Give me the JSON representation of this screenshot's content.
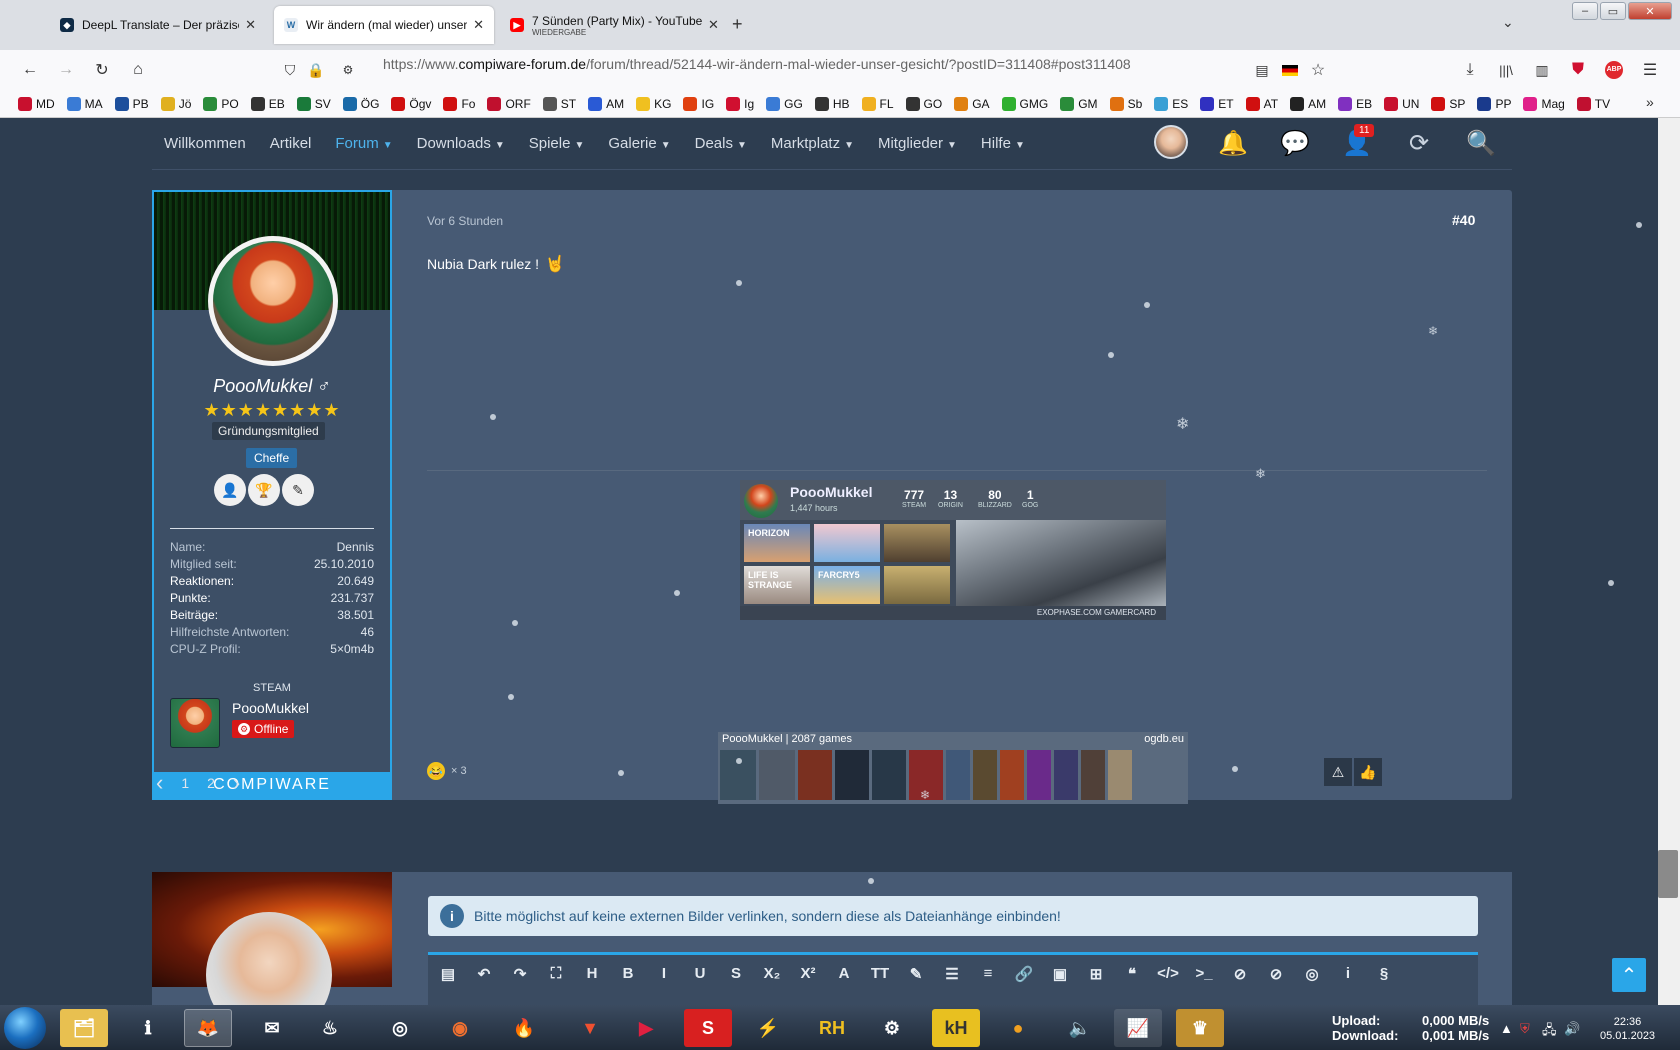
{
  "browser": {
    "tabs": [
      {
        "title": "DeepL Translate – Der präziseste",
        "active": false
      },
      {
        "title": "Wir ändern (mal wieder) unser G",
        "active": true
      },
      {
        "title": "7 Sünden (Party Mix) - YouTube",
        "subtitle": "WIEDERGABE",
        "active": false
      }
    ],
    "new_tab": "+",
    "url_prefix": "https://www.",
    "url_domain": "compiware-forum.de",
    "url_path": "/forum/thread/52144-wir-ändern-mal-wieder-unser-gesicht/?postID=311408#post311408",
    "bookmarks": [
      "MD",
      "MA",
      "PB",
      "Jö",
      "PO",
      "EB",
      "SV",
      "ÖG",
      "Ögv",
      "Fo",
      "ORF",
      "ST",
      "AM",
      "KG",
      "IG",
      "Ig",
      "GG",
      "HB",
      "FL",
      "GO",
      "GA",
      "GMG",
      "GM",
      "Sb",
      "ES",
      "ET",
      "AT",
      "AM",
      "EB",
      "UN",
      "SP",
      "PP",
      "Mag",
      "TV"
    ],
    "bookmark_colors": [
      "#c8102e",
      "#3a7bd5",
      "#1d4f9c",
      "#e0b020",
      "#2a8c3a",
      "#333333",
      "#1a7a3a",
      "#1a6aa8",
      "#d01010",
      "#d01010",
      "#c0102e",
      "#555555",
      "#2a5ad5",
      "#f0c020",
      "#e04010",
      "#d01030",
      "#3a7bd5",
      "#333333",
      "#f0b020",
      "#333333",
      "#e08010",
      "#30b030",
      "#2a8c3a",
      "#e07010",
      "#3aa0d5",
      "#3030c0",
      "#d01010",
      "#222222",
      "#8030c0",
      "#c8102e",
      "#d01010",
      "#1a3a8c",
      "#e0208a",
      "#c01030"
    ]
  },
  "site": {
    "nav": [
      {
        "label": "Willkommen",
        "active": false,
        "dropdown": false
      },
      {
        "label": "Artikel",
        "active": false,
        "dropdown": false
      },
      {
        "label": "Forum",
        "active": true,
        "dropdown": true
      },
      {
        "label": "Downloads",
        "active": false,
        "dropdown": true
      },
      {
        "label": "Spiele",
        "active": false,
        "dropdown": true
      },
      {
        "label": "Galerie",
        "active": false,
        "dropdown": true
      },
      {
        "label": "Deals",
        "active": false,
        "dropdown": true
      },
      {
        "label": "Marktplatz",
        "active": false,
        "dropdown": true
      },
      {
        "label": "Mitglieder",
        "active": false,
        "dropdown": true
      },
      {
        "label": "Hilfe",
        "active": false,
        "dropdown": true
      }
    ],
    "notification_count": "11"
  },
  "post": {
    "time": "Vor 6 Stunden",
    "number": "#40",
    "text": "Nubia Dark rulez !",
    "reaction_count": "× 3",
    "author": {
      "name": "PoooMukkel ♂",
      "stars": "★★★★★★★★",
      "title": "Gründungsmitglied",
      "rank": "Cheffe",
      "stats": [
        {
          "key": "Name:",
          "value": "Dennis",
          "strong": false
        },
        {
          "key": "Mitglied seit:",
          "value": "25.10.2010",
          "strong": false
        },
        {
          "key": "Reaktionen:",
          "value": "20.649",
          "strong": true
        },
        {
          "key": "Punkte:",
          "value": "231.737",
          "strong": true
        },
        {
          "key": "Beiträge:",
          "value": "38.501",
          "strong": true
        },
        {
          "key": "Hilfreichste Antworten:",
          "value": "46",
          "strong": false
        },
        {
          "key": "CPU-Z Profil:",
          "value": "5×0m4b",
          "strong": false
        }
      ],
      "steam_label": "STEAM",
      "steam_name": "PoooMukkel",
      "steam_status": "Offline",
      "footer": "COMPIWARE"
    },
    "gamercard": {
      "name": "PoooMukkel",
      "hours": "1,447 hours",
      "stats": [
        {
          "value": "777",
          "label": "STEAM"
        },
        {
          "value": "13",
          "label": "ORIGIN"
        },
        {
          "value": "80",
          "label": "BLIZZARD"
        },
        {
          "value": "1",
          "label": "GOG"
        }
      ],
      "tiles": [
        "HORIZON",
        "",
        "",
        "LIFE IS STRANGE",
        "FARCRY5",
        ""
      ],
      "footer": "EXOPHASE.COM GAMERCARD"
    },
    "ogdb": {
      "left": "PoooMukkel | 2087 games",
      "right": "ogdb.eu"
    }
  },
  "pager": {
    "prev": "‹",
    "pages": [
      "1",
      "2"
    ],
    "next": "›"
  },
  "reply": {
    "notice": "Bitte möglichst auf keine externen Bilder verlinken, sondern diese als Dateianhänge einbinden!",
    "toolbar": [
      "▤",
      "↶",
      "↷",
      "⛶",
      "H",
      "B",
      "I",
      "U",
      "S",
      "X₂",
      "X²",
      "A",
      "TT",
      "✎",
      "☰",
      "≡",
      "🔗",
      "▣",
      "⊞",
      "❝",
      "</>",
      ">_",
      "⊘",
      "⊘",
      "◎",
      "i",
      "§"
    ]
  },
  "taskbar": {
    "upload_label": "Upload:",
    "download_label": "Download:",
    "upload_value": "0,000 MB/s",
    "download_value": "0,001 MB/s",
    "time": "22:36",
    "date": "05.01.2023"
  }
}
